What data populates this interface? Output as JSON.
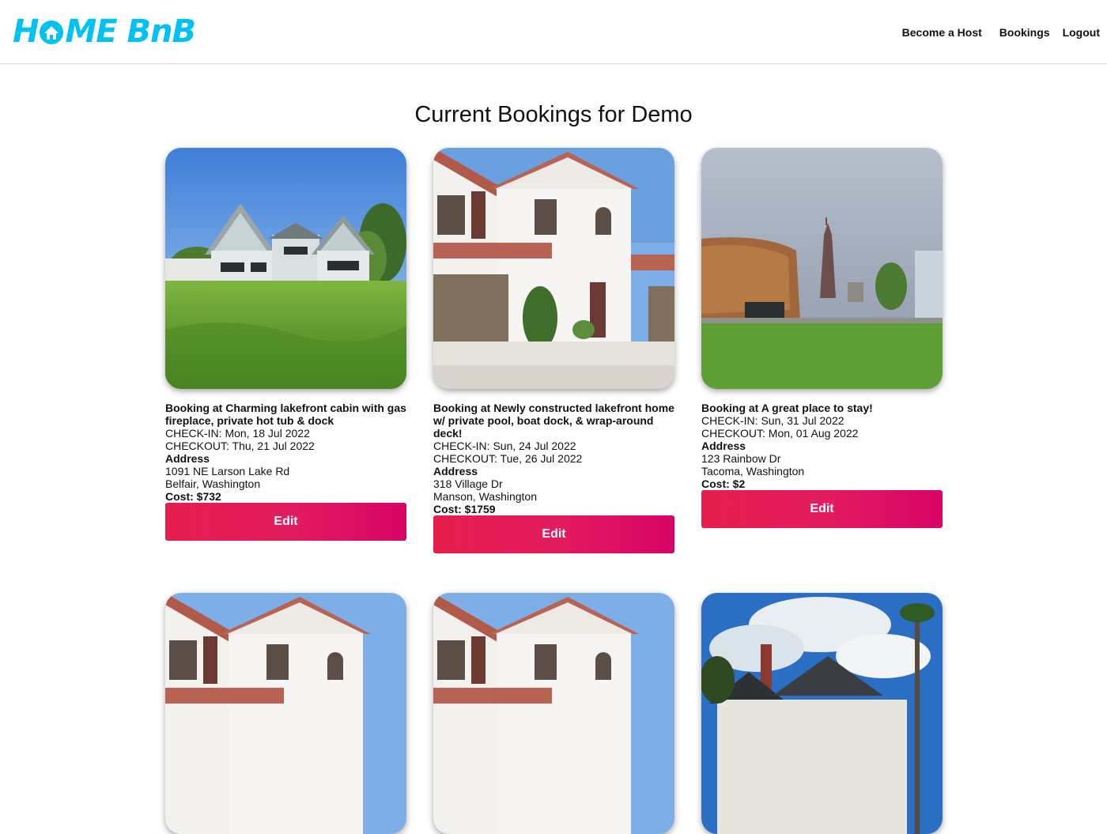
{
  "app": {
    "logo_left": "H",
    "logo_right": "ME BnB",
    "brand_color": "#00c2f0",
    "accent_color": "#e31c5f"
  },
  "nav": {
    "become_host": "Become a Host",
    "bookings": "Bookings",
    "logout": "Logout"
  },
  "page": {
    "title": "Current Bookings for Demo"
  },
  "bookings": [
    {
      "title": "Booking at Charming lakefront cabin with gas fireplace, private hot tub & dock",
      "checkin": "CHECK-IN: Mon, 18 Jul 2022",
      "checkout": "CHECKOUT: Thu, 21 Jul 2022",
      "address_label": "Address",
      "street": "1091 NE Larson Lake Rd",
      "city": "Belfair, Washington",
      "cost": "Cost: $732",
      "edit": "Edit"
    },
    {
      "title": "Booking at Newly constructed lakefront home w/ private pool, boat dock, & wrap-around deck!",
      "checkin": "CHECK-IN: Sun, 24 Jul 2022",
      "checkout": "CHECKOUT: Tue, 26 Jul 2022",
      "address_label": "Address",
      "street": "318 Village Dr",
      "city": "Manson, Washington",
      "cost": "Cost: $1759",
      "edit": "Edit"
    },
    {
      "title": "Booking at A great place to stay!",
      "checkin": "CHECK-IN: Sun, 31 Jul 2022",
      "checkout": "CHECKOUT: Mon, 01 Aug 2022",
      "address_label": "Address",
      "street": "123 Rainbow Dr",
      "city": "Tacoma, Washington",
      "cost": "Cost: $2",
      "edit": "Edit"
    }
  ]
}
